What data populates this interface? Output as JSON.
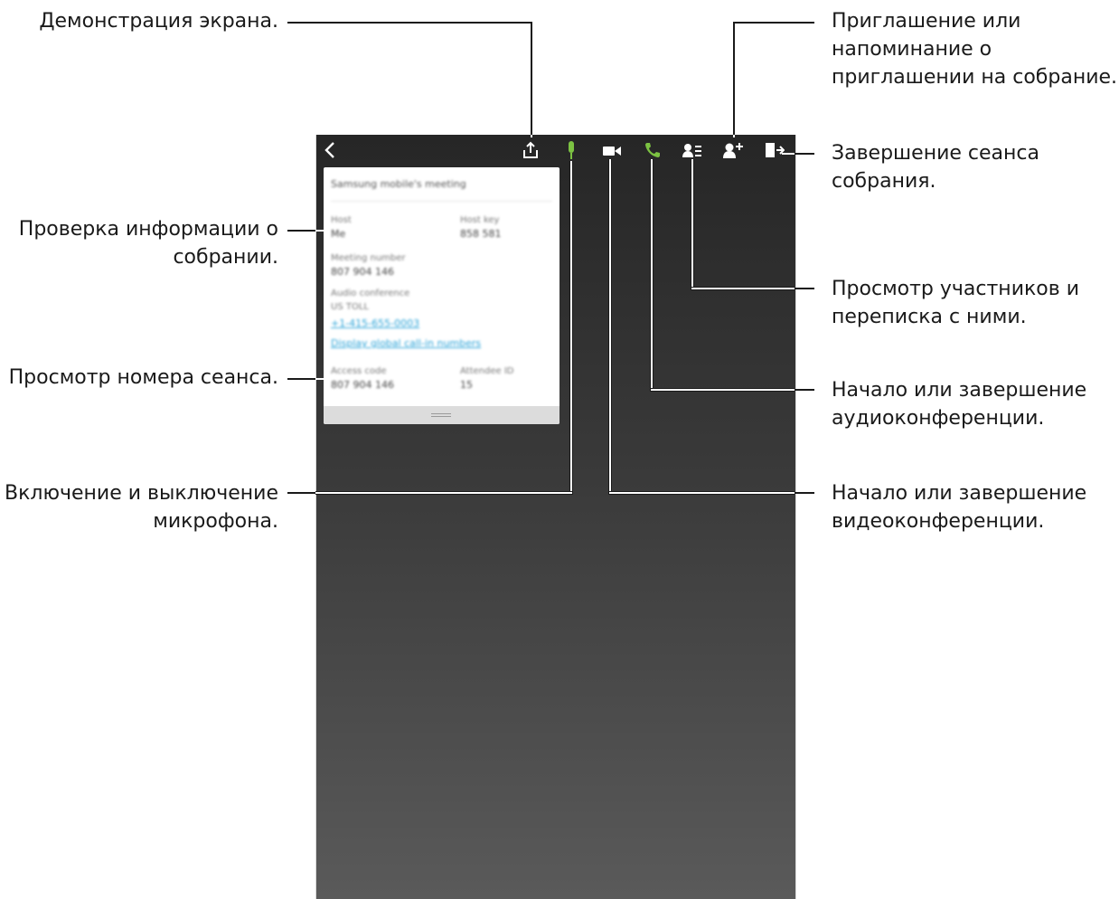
{
  "callouts": {
    "screen_share": "Демонстрация экрана.",
    "meeting_info": [
      "Проверка информации о",
      "собрании."
    ],
    "session_number": "Просмотр номера сеанса.",
    "microphone": [
      "Включение и выключение",
      "микрофона."
    ],
    "invite": [
      "Приглашение или",
      "напоминание о",
      "приглашении на собрание."
    ],
    "end_session": [
      "Завершение сеанса",
      "собрания."
    ],
    "participants": [
      "Просмотр участников и",
      "переписка с ними."
    ],
    "audio_conf": [
      "Начало или завершение",
      "аудиоконференции."
    ],
    "video_conf": [
      "Начало или завершение",
      "видеоконференции."
    ]
  },
  "meeting_card": {
    "title": "Samsung mobile's meeting",
    "host_label": "Host",
    "host_value": "Me",
    "host_key_label": "Host key",
    "host_key_value": "858 581",
    "meeting_number_label": "Meeting number",
    "meeting_number_value": "807 904 146",
    "audio_label": "Audio conference",
    "audio_sub": "US TOLL",
    "phone_link": "+1-415-655-0003",
    "global_link": "Display global call-in numbers",
    "access_code_label": "Access code",
    "access_code_value": "807 904 146",
    "attendee_label": "Attendee ID",
    "attendee_value": "15"
  },
  "colors": {
    "mic_active": "#7cc242",
    "phone_active": "#7cc242",
    "link": "#2aa3d8",
    "toolbar_icon": "#ffffff"
  },
  "icons": [
    "back-arrow-icon",
    "share-screen-icon",
    "microphone-icon",
    "video-camera-icon",
    "phone-icon",
    "participants-list-icon",
    "add-participant-icon",
    "exit-meeting-icon"
  ]
}
